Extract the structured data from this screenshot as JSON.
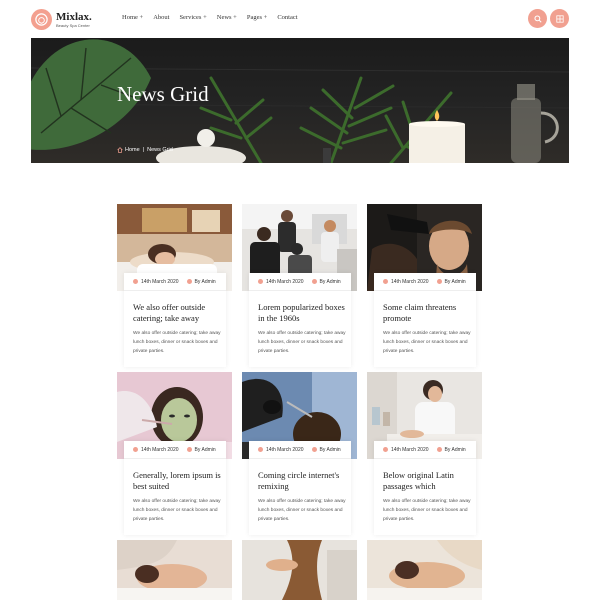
{
  "brand": {
    "name": "Mixlax.",
    "tagline": "Beauty Spa Center"
  },
  "nav": [
    {
      "label": "Home +"
    },
    {
      "label": "About"
    },
    {
      "label": "Services +"
    },
    {
      "label": "News +"
    },
    {
      "label": "Pages +"
    },
    {
      "label": "Contact"
    }
  ],
  "header_icons": {
    "search": "search-icon",
    "menu": "grid-menu-icon",
    "accent": "#f1a090"
  },
  "hero": {
    "title": "News Grid",
    "breadcrumb": {
      "home": "Home",
      "separator": "|",
      "current": "News Grid"
    }
  },
  "posts": [
    {
      "date": "14th March 2020",
      "author": "By Admin",
      "title": "We also offer outside catering; take away",
      "excerpt": "We also offer outside catering; take away lunch boxes, dinner or snack boxes and private parties."
    },
    {
      "date": "14th March 2020",
      "author": "By Admin",
      "title": "Lorem popularized boxes in the 1960s",
      "excerpt": "We also offer outside catering; take away lunch boxes, dinner or snack boxes and private parties."
    },
    {
      "date": "14th March 2020",
      "author": "By Admin",
      "title": "Some claim threatens promote",
      "excerpt": "We also offer outside catering; take away lunch boxes, dinner or snack boxes and private parties."
    },
    {
      "date": "14th March 2020",
      "author": "By Admin",
      "title": "Generally, lorem ipsum is best suited",
      "excerpt": "We also offer outside catering; take away lunch boxes, dinner or snack boxes and private parties."
    },
    {
      "date": "14th March 2020",
      "author": "By Admin",
      "title": "Coming circle internet's remixing",
      "excerpt": "We also offer outside catering; take away lunch boxes, dinner or snack boxes and private parties."
    },
    {
      "date": "14th March 2020",
      "author": "By Admin",
      "title": "Below original Latin passages which",
      "excerpt": "We also offer outside catering; take away lunch boxes, dinner or snack boxes and private parties."
    }
  ]
}
